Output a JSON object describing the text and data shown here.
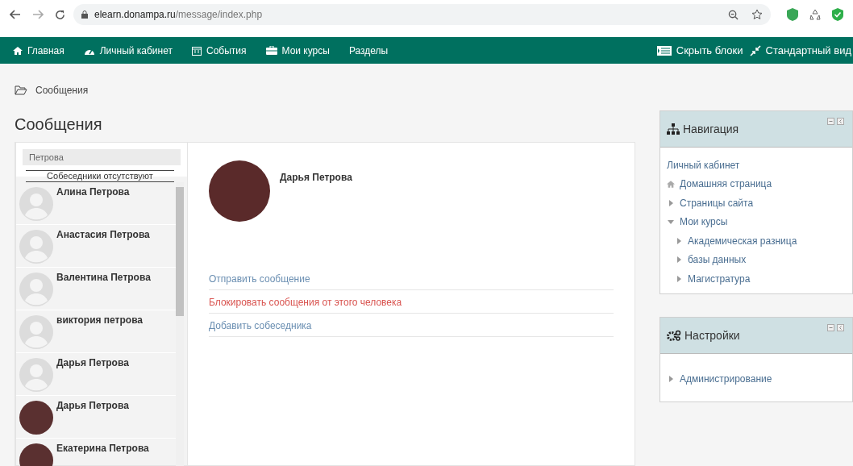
{
  "browser": {
    "url_host": "elearn.donampa.ru",
    "url_path": "/message/index.php"
  },
  "navbar": {
    "items": [
      {
        "label": "Главная"
      },
      {
        "label": "Личный кабинет"
      },
      {
        "label": "События"
      },
      {
        "label": "Мои курсы"
      },
      {
        "label": "Разделы"
      }
    ],
    "right": [
      {
        "label": "Скрыть блоки"
      },
      {
        "label": "Стандартный вид"
      }
    ]
  },
  "breadcrumb": "Сообщения",
  "page_title": "Сообщения",
  "messages": {
    "search": {
      "value": "Петрова"
    },
    "contacts_header": "Собеседники отсутствуют",
    "contacts": [
      {
        "name": "Алина Петрова",
        "kind": "default"
      },
      {
        "name": "Анастасия Петрова",
        "kind": "default"
      },
      {
        "name": "Валентина Петрова",
        "kind": "default"
      },
      {
        "name": "виктория петрова",
        "kind": "default"
      },
      {
        "name": "Дарья Петрова",
        "kind": "default"
      },
      {
        "name": "Дарья Петрова",
        "kind": "photo"
      },
      {
        "name": "Екатерина Петрова",
        "kind": "photo"
      }
    ],
    "profile": {
      "name": "Дарья Петрова"
    },
    "actions": [
      {
        "label": "Отправить сообщение",
        "kind": "normal"
      },
      {
        "label": "Блокировать сообщения от этого человека",
        "kind": "danger"
      },
      {
        "label": "Добавить собеседника",
        "kind": "normal"
      }
    ]
  },
  "blocks": [
    {
      "title": "Навигация",
      "items": [
        {
          "label": "Личный кабинет",
          "kind": "link"
        },
        {
          "label": "Домашняя страница",
          "kind": "home"
        },
        {
          "label": "Страницы сайта",
          "kind": "branch",
          "expanded": false
        },
        {
          "label": "Мои курсы",
          "kind": "branch",
          "expanded": true,
          "children": [
            {
              "label": "Академическая разница",
              "kind": "branch",
              "expanded": false
            },
            {
              "label": "базы данных",
              "kind": "branch",
              "expanded": false
            },
            {
              "label": "Магистратура",
              "kind": "branch",
              "expanded": false
            }
          ]
        }
      ]
    },
    {
      "title": "Настройки",
      "items": [
        {
          "label": "Администрирование",
          "kind": "branch",
          "expanded": false
        }
      ]
    }
  ]
}
